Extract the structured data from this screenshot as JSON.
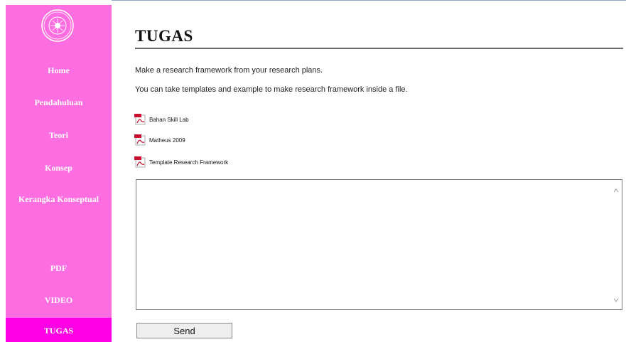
{
  "sidebar": {
    "logo_icon": "university-seal-icon",
    "items": [
      {
        "label": "Home",
        "active": false
      },
      {
        "label": "Pendahuluan",
        "active": false
      },
      {
        "label": "Teori",
        "active": false
      },
      {
        "label": "Konsep",
        "active": false
      },
      {
        "label": "Kerangka Konseptual",
        "active": false
      },
      {
        "label": "PDF",
        "active": false
      },
      {
        "label": "VIDEO",
        "active": false
      },
      {
        "label": "TUGAS",
        "active": true
      }
    ],
    "colors": {
      "background": "#ff6ee0",
      "active": "#ff00e6",
      "text": "#ffffff"
    }
  },
  "main": {
    "title": "TUGAS",
    "paragraphs": [
      "Make a research framework from your research plans.",
      "You can take templates and example  to make research framework inside a file."
    ],
    "files": [
      {
        "icon": "pdf-icon",
        "label": "Bahan Skill Lab"
      },
      {
        "icon": "pdf-icon",
        "label": "Matheus 2009"
      },
      {
        "icon": "pdf-icon",
        "label": "Template Research Framework"
      }
    ],
    "textarea": {
      "value": "",
      "placeholder": ""
    },
    "send_label": "Send"
  }
}
